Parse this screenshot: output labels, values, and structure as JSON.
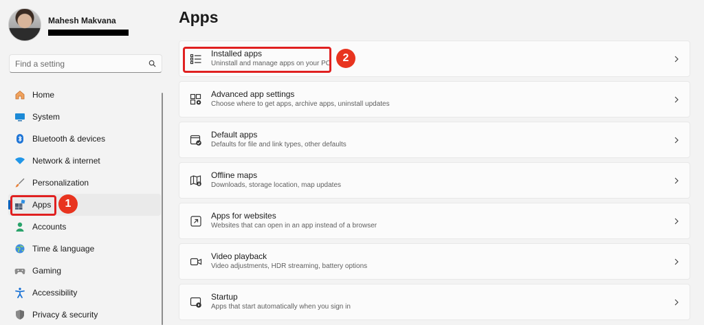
{
  "profile": {
    "name": "Mahesh Makvana"
  },
  "search": {
    "placeholder": "Find a setting"
  },
  "sidebar": {
    "items": [
      {
        "label": "Home",
        "icon": "home-icon"
      },
      {
        "label": "System",
        "icon": "system-icon"
      },
      {
        "label": "Bluetooth & devices",
        "icon": "bluetooth-icon"
      },
      {
        "label": "Network & internet",
        "icon": "network-icon"
      },
      {
        "label": "Personalization",
        "icon": "brush-icon"
      },
      {
        "label": "Apps",
        "icon": "apps-icon",
        "selected": true
      },
      {
        "label": "Accounts",
        "icon": "accounts-icon"
      },
      {
        "label": "Time & language",
        "icon": "globe-icon"
      },
      {
        "label": "Gaming",
        "icon": "gamepad-icon"
      },
      {
        "label": "Accessibility",
        "icon": "accessibility-icon"
      },
      {
        "label": "Privacy & security",
        "icon": "shield-icon"
      }
    ]
  },
  "main": {
    "title": "Apps",
    "cards": [
      {
        "title": "Installed apps",
        "desc": "Uninstall and manage apps on your PC",
        "icon": "list-icon"
      },
      {
        "title": "Advanced app settings",
        "desc": "Choose where to get apps, archive apps, uninstall updates",
        "icon": "app-settings-icon"
      },
      {
        "title": "Default apps",
        "desc": "Defaults for file and link types, other defaults",
        "icon": "default-apps-icon"
      },
      {
        "title": "Offline maps",
        "desc": "Downloads, storage location, map updates",
        "icon": "map-icon"
      },
      {
        "title": "Apps for websites",
        "desc": "Websites that can open in an app instead of a browser",
        "icon": "open-external-icon"
      },
      {
        "title": "Video playback",
        "desc": "Video adjustments, HDR streaming, battery options",
        "icon": "video-icon"
      },
      {
        "title": "Startup",
        "desc": "Apps that start automatically when you sign in",
        "icon": "startup-icon"
      }
    ]
  },
  "annotations": {
    "step1": "1",
    "step2": "2"
  },
  "colors": {
    "accent": "#005fb8",
    "annotation": "#e02020"
  }
}
